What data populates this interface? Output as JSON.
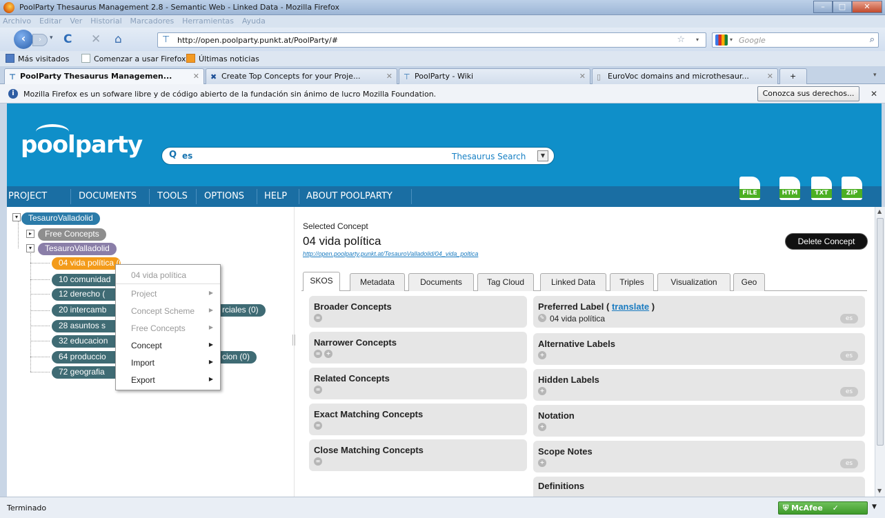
{
  "window": {
    "title": "PoolParty Thesaurus Management 2.8 - Semantic Web - Linked Data - Mozilla Firefox",
    "minimize": "–",
    "maximize": "□",
    "close": "✕"
  },
  "menubar": [
    "Archivo",
    "Editar",
    "Ver",
    "Historial",
    "Marcadores",
    "Herramientas",
    "Ayuda"
  ],
  "navbar": {
    "url": "http://open.poolparty.punkt.at/PoolParty/#",
    "search_placeholder": "Google"
  },
  "bookmarks": [
    "Más visitados",
    "Comenzar a usar Firefox",
    "Últimas noticias"
  ],
  "tabs": [
    {
      "label": "PoolParty Thesaurus Managemen...",
      "active": true
    },
    {
      "label": "Create Top Concepts for your Proje...",
      "active": false
    },
    {
      "label": "PoolParty - Wiki",
      "active": false
    },
    {
      "label": "EuroVoc domains and microthesaur...",
      "active": false
    }
  ],
  "notice": {
    "message": "Mozilla Firefox es un sofware libre y de código abierto de la fundación sin ánimo de lucro Mozilla Foundation.",
    "button": "Conozca sus derechos..."
  },
  "app": {
    "logo": "poolparty",
    "search_value": "es",
    "search_label": "Thesaurus Search",
    "nav": [
      "PROJECT",
      "DOCUMENTS",
      "TOOLS",
      "OPTIONS",
      "HELP",
      "ABOUT POOLPARTY"
    ],
    "exports": [
      "FILE",
      "HTM",
      "TXT",
      "ZIP"
    ]
  },
  "tree": {
    "root": "TesauroValladolid",
    "free_concepts": "Free Concepts",
    "scheme": "TesauroValladolid",
    "concepts": [
      "04 vida política (0)",
      "10 comunidad",
      "12 derecho (",
      "20 intercambios y relaciones comerciales (0)",
      "28 asuntos s",
      "32 educacion",
      "64 produccion, tecnologia e investigacion (0)",
      "72 geografia"
    ],
    "visible_fragments": {
      "intercambios_left": "20 intercamb",
      "intercambios_right": "rciales (0)",
      "produccion_left": "64 produccio",
      "produccion_right": "cion (0)"
    }
  },
  "context_menu": {
    "header": "04 vida política",
    "items": [
      {
        "label": "Project",
        "disabled": true
      },
      {
        "label": "Concept Scheme",
        "disabled": true
      },
      {
        "label": "Free Concepts",
        "disabled": true
      },
      {
        "label": "Concept",
        "disabled": false
      },
      {
        "label": "Import",
        "disabled": false
      },
      {
        "label": "Export",
        "disabled": false
      }
    ]
  },
  "concept": {
    "section_label": "Selected Concept",
    "title": "04 vida política",
    "uri": "http://open.poolparty.punkt.at/TesauroValladolid/04_vida_poltica",
    "delete_button": "Delete Concept",
    "tabs": [
      "SKOS",
      "Metadata",
      "Documents",
      "Tag Cloud",
      "Linked Data",
      "Triples",
      "Visualization",
      "Geo"
    ],
    "left_boxes": [
      "Broader Concepts",
      "Narrower Concepts",
      "Related Concepts",
      "Exact Matching Concepts",
      "Close Matching Concepts"
    ],
    "preferred_label": {
      "title": "Preferred Label",
      "translate": "translate",
      "value": "04 vida política",
      "lang": "es"
    },
    "right_boxes": [
      {
        "title": "Alternative Labels",
        "lang": "es"
      },
      {
        "title": "Hidden Labels",
        "lang": "es"
      },
      {
        "title": "Notation",
        "lang": ""
      },
      {
        "title": "Scope Notes",
        "lang": "es"
      },
      {
        "title": "Definitions",
        "lang": ""
      }
    ]
  },
  "statusbar": {
    "status": "Terminado",
    "mcafee": "McAfee"
  },
  "colors": {
    "header_blue": "#0f8fc9",
    "nav_blue": "#1a6ea3",
    "selected_orange": "#f39b1a"
  }
}
